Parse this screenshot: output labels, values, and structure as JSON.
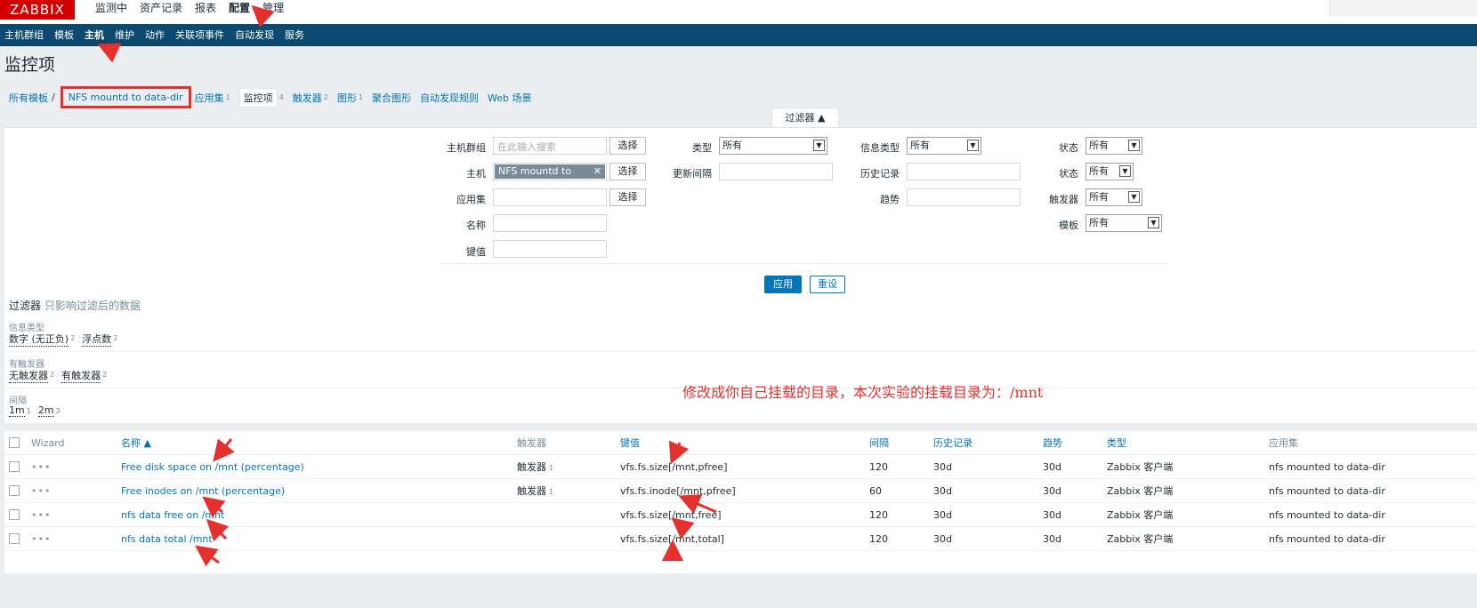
{
  "brand": {
    "logo": "ZABBIX",
    "color": "#d40000"
  },
  "colors": {
    "header_bg": "#0b4a6e",
    "link": "#0275b8",
    "annotation": "#e5302e"
  },
  "topmenu": [
    "监测中",
    "资产记录",
    "报表",
    "配置",
    "管理"
  ],
  "submenu": [
    "主机群组",
    "模板",
    "主机",
    "维护",
    "动作",
    "关联项事件",
    "自动发现",
    "服务"
  ],
  "page_title": "监控项",
  "breadcrumb": {
    "all_templates": "所有模板",
    "separator": "/",
    "template_name": "NFS mountd to data-dir",
    "tabs": [
      {
        "label": "应用集",
        "count": "1"
      },
      {
        "label": "监控项",
        "count": "4"
      },
      {
        "label": "触发器",
        "count": "2"
      },
      {
        "label": "图形",
        "count": "1"
      },
      {
        "label": "聚合图形",
        "count": ""
      },
      {
        "label": "自动发现规则",
        "count": ""
      },
      {
        "label": "Web 场景",
        "count": ""
      }
    ]
  },
  "filter": {
    "tab_label": "过滤器 ▲",
    "host_group_label": "主机群组",
    "host_group_placeholder": "在此输入搜索",
    "select_label": "选择",
    "host_label": "主机",
    "host_chip": "NFS mountd to data...",
    "application_label": "应用集",
    "name_label": "名称",
    "key_label": "键值",
    "type_label": "类型",
    "type_value": "所有",
    "update_interval_label": "更新间隔",
    "info_type_label": "信息类型",
    "info_type_value": "所有",
    "history_label": "历史记录",
    "trends_label": "趋势",
    "state_label": "状态",
    "state_value": "所有",
    "status_label": "状态",
    "status_value": "所有",
    "triggers_label": "触发器",
    "triggers_value": "所有",
    "template_label": "模板",
    "template_value": "所有",
    "apply": "应用",
    "reset": "重设"
  },
  "subfilter": {
    "title": "过滤器",
    "subtitle": "只影响过滤后的数据",
    "groups": [
      {
        "label": "信息类型",
        "values": [
          {
            "name": "数字 (无正负)",
            "count": "2"
          },
          {
            "name": "浮点数",
            "count": "2"
          }
        ]
      },
      {
        "label": "有触发器",
        "values": [
          {
            "name": "无触发器",
            "count": "2"
          },
          {
            "name": "有触发器",
            "count": "2"
          }
        ]
      },
      {
        "label": "间隔",
        "values": [
          {
            "name": "1m",
            "count": "1"
          },
          {
            "name": "2m",
            "count": "3"
          }
        ]
      }
    ]
  },
  "annotation": "修改成你自己挂载的目录，本次实验的挂载目录为：/mnt",
  "table": {
    "headers": {
      "wizard": "Wizard",
      "name": "名称 ▲",
      "triggers": "触发器",
      "key": "键值",
      "interval": "间隔",
      "history": "历史记录",
      "trends": "趋势",
      "type": "类型",
      "applications": "应用集"
    },
    "rows": [
      {
        "dots": "•••",
        "name": "Free disk space on /mnt (percentage)",
        "triggers": "触发器",
        "trigger_count": "1",
        "key": "vfs.fs.size[/mnt,pfree]",
        "interval": "120",
        "history": "30d",
        "trends": "30d",
        "type": "Zabbix 客户端",
        "app": "nfs mounted to data-dir"
      },
      {
        "dots": "•••",
        "name": "Free inodes on /mnt (percentage)",
        "triggers": "触发器",
        "trigger_count": "1",
        "key": "vfs.fs.inode[/mnt,pfree]",
        "interval": "60",
        "history": "30d",
        "trends": "30d",
        "type": "Zabbix 客户端",
        "app": "nfs mounted to data-dir"
      },
      {
        "dots": "•••",
        "name": "nfs data free on /mnt",
        "triggers": "",
        "trigger_count": "",
        "key": "vfs.fs.size[/mnt,free]",
        "interval": "120",
        "history": "30d",
        "trends": "30d",
        "type": "Zabbix 客户端",
        "app": "nfs mounted to data-dir"
      },
      {
        "dots": "•••",
        "name": "nfs data total /mnt",
        "triggers": "",
        "trigger_count": "",
        "key": "vfs.fs.size[/mnt,total]",
        "interval": "120",
        "history": "30d",
        "trends": "30d",
        "type": "Zabbix 客户端",
        "app": "nfs mounted to data-dir"
      }
    ]
  }
}
